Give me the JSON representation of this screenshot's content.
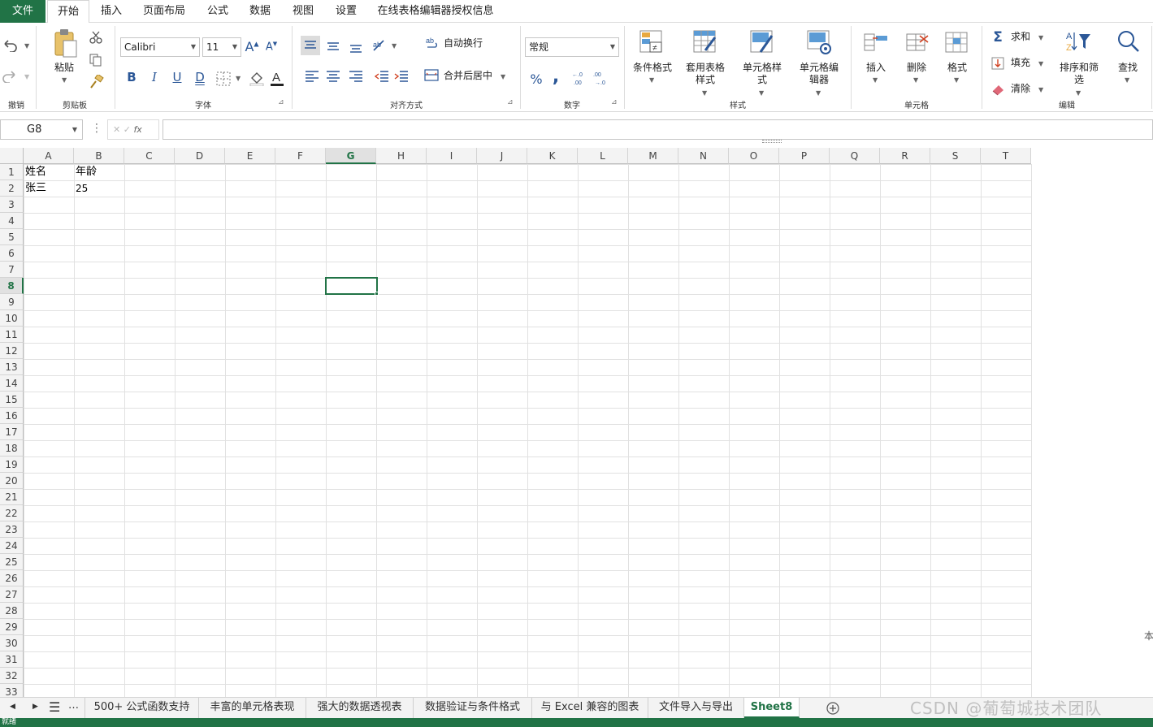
{
  "menubar": {
    "file": "文件",
    "tabs": [
      "开始",
      "插入",
      "页面布局",
      "公式",
      "数据",
      "视图",
      "设置",
      "在线表格编辑器授权信息"
    ],
    "active_tab": "开始"
  },
  "ribbon": {
    "undo_group": "撤销",
    "clipboard": {
      "paste": "粘贴",
      "label": "剪贴板"
    },
    "font": {
      "name": "Calibri",
      "size": "11",
      "label": "字体",
      "bold": "B",
      "italic": "I",
      "underline": "U",
      "double_underline": "D"
    },
    "alignment": {
      "wrap": "自动换行",
      "merge": "合并后居中",
      "label": "对齐方式"
    },
    "number": {
      "format": "常规",
      "percent": "%",
      "comma": ",",
      "label": "数字"
    },
    "styles": {
      "conditional": "条件格式",
      "table_style_1": "套用表格",
      "table_style_2": "样式",
      "cell_style_1": "单元格样",
      "cell_style_2": "式",
      "cell_editor_1": "单元格编",
      "cell_editor_2": "辑器",
      "label": "样式"
    },
    "cells": {
      "insert": "插入",
      "delete": "删除",
      "format": "格式",
      "label": "单元格"
    },
    "editing": {
      "sum": "求和",
      "fill": "填充",
      "clear": "清除",
      "sort_1": "排序和筛",
      "sort_2": "选",
      "find": "查找",
      "label": "编辑"
    }
  },
  "formula_bar": {
    "name_box": "G8",
    "fx": "fx",
    "value": ""
  },
  "columns": [
    "A",
    "B",
    "C",
    "D",
    "E",
    "F",
    "G",
    "H",
    "I",
    "J",
    "K",
    "L",
    "M",
    "N",
    "O",
    "P",
    "Q",
    "R",
    "S",
    "T"
  ],
  "rows": [
    "1",
    "2",
    "3",
    "4",
    "5",
    "6",
    "7",
    "8",
    "9",
    "10",
    "11",
    "12",
    "13",
    "14",
    "15",
    "16",
    "17",
    "18",
    "19",
    "20",
    "21",
    "22",
    "23",
    "24",
    "25",
    "26",
    "27",
    "28",
    "29",
    "30",
    "31",
    "32",
    "33"
  ],
  "selected_cell": "G8",
  "cells": {
    "A1": "姓名",
    "B1": "年龄",
    "A2": "张三",
    "B2": "25"
  },
  "sheet_tabs": [
    "500+ 公式函数支持",
    "丰富的单元格表现",
    "强大的数据透视表",
    "数据验证与条件格式",
    "与 Excel 兼容的图表",
    "文件导入与导出",
    "Sheet8"
  ],
  "active_sheet": "Sheet8",
  "status": "就绪",
  "watermark": "CSDN @葡萄城技术团队",
  "side_char": "本",
  "colors": {
    "accent": "#217346"
  }
}
